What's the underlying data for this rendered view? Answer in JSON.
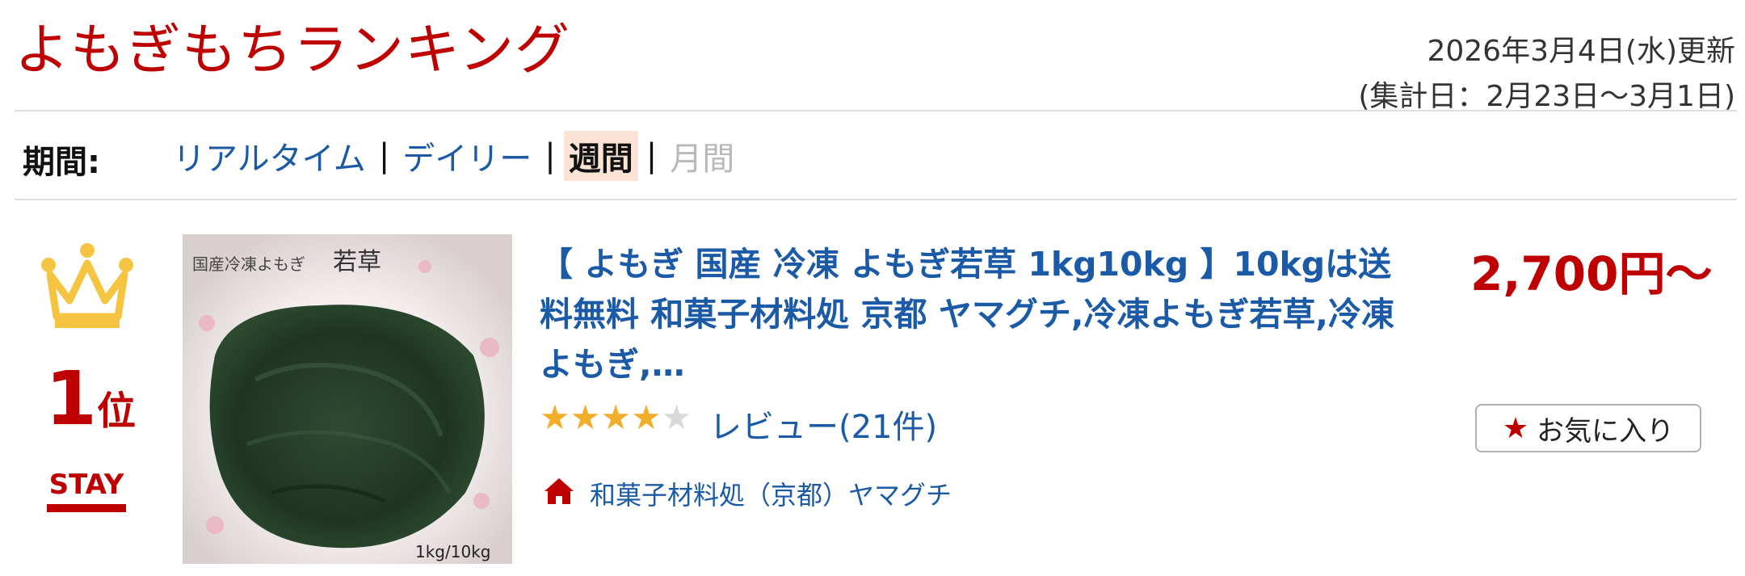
{
  "header": {
    "title": "よもぎもちランキング",
    "updated": "2026年3月4日(水)更新",
    "period_range": "(集計日：2月23日〜3月1日)"
  },
  "period": {
    "label": "期間:",
    "tabs": [
      {
        "label": "リアルタイム",
        "state": "link"
      },
      {
        "label": "デイリー",
        "state": "link"
      },
      {
        "label": "週間",
        "state": "active"
      },
      {
        "label": "月間",
        "state": "disabled"
      }
    ],
    "separator": "|"
  },
  "item": {
    "rank": "1",
    "rank_suffix": "位",
    "rank_status": "STAY",
    "image": {
      "label_top": "国産冷凍よもぎ",
      "label_big": "若草",
      "label_weight": "1kg/10kg"
    },
    "title": "【 よもぎ 国産 冷凍 よもぎ若草 1kg10kg 】10kgは送料無料 和菓子材料処 京都 ヤマグチ,冷凍よもぎ若草,冷凍よもぎ,…",
    "price": "2,700円〜",
    "rating_stars": 4,
    "rating_max": 5,
    "review": "レビュー(21件)",
    "favorite_label": "お気に入り",
    "shop": "和菓子材料処（京都）ヤマグチ"
  },
  "colors": {
    "accent": "#bf0000",
    "link": "#1b5aa6",
    "star": "#f0ae2a",
    "crown": "#f5c542"
  },
  "icons": {
    "crown": "crown-icon",
    "star": "star-icon",
    "shop": "shop-home-icon"
  }
}
